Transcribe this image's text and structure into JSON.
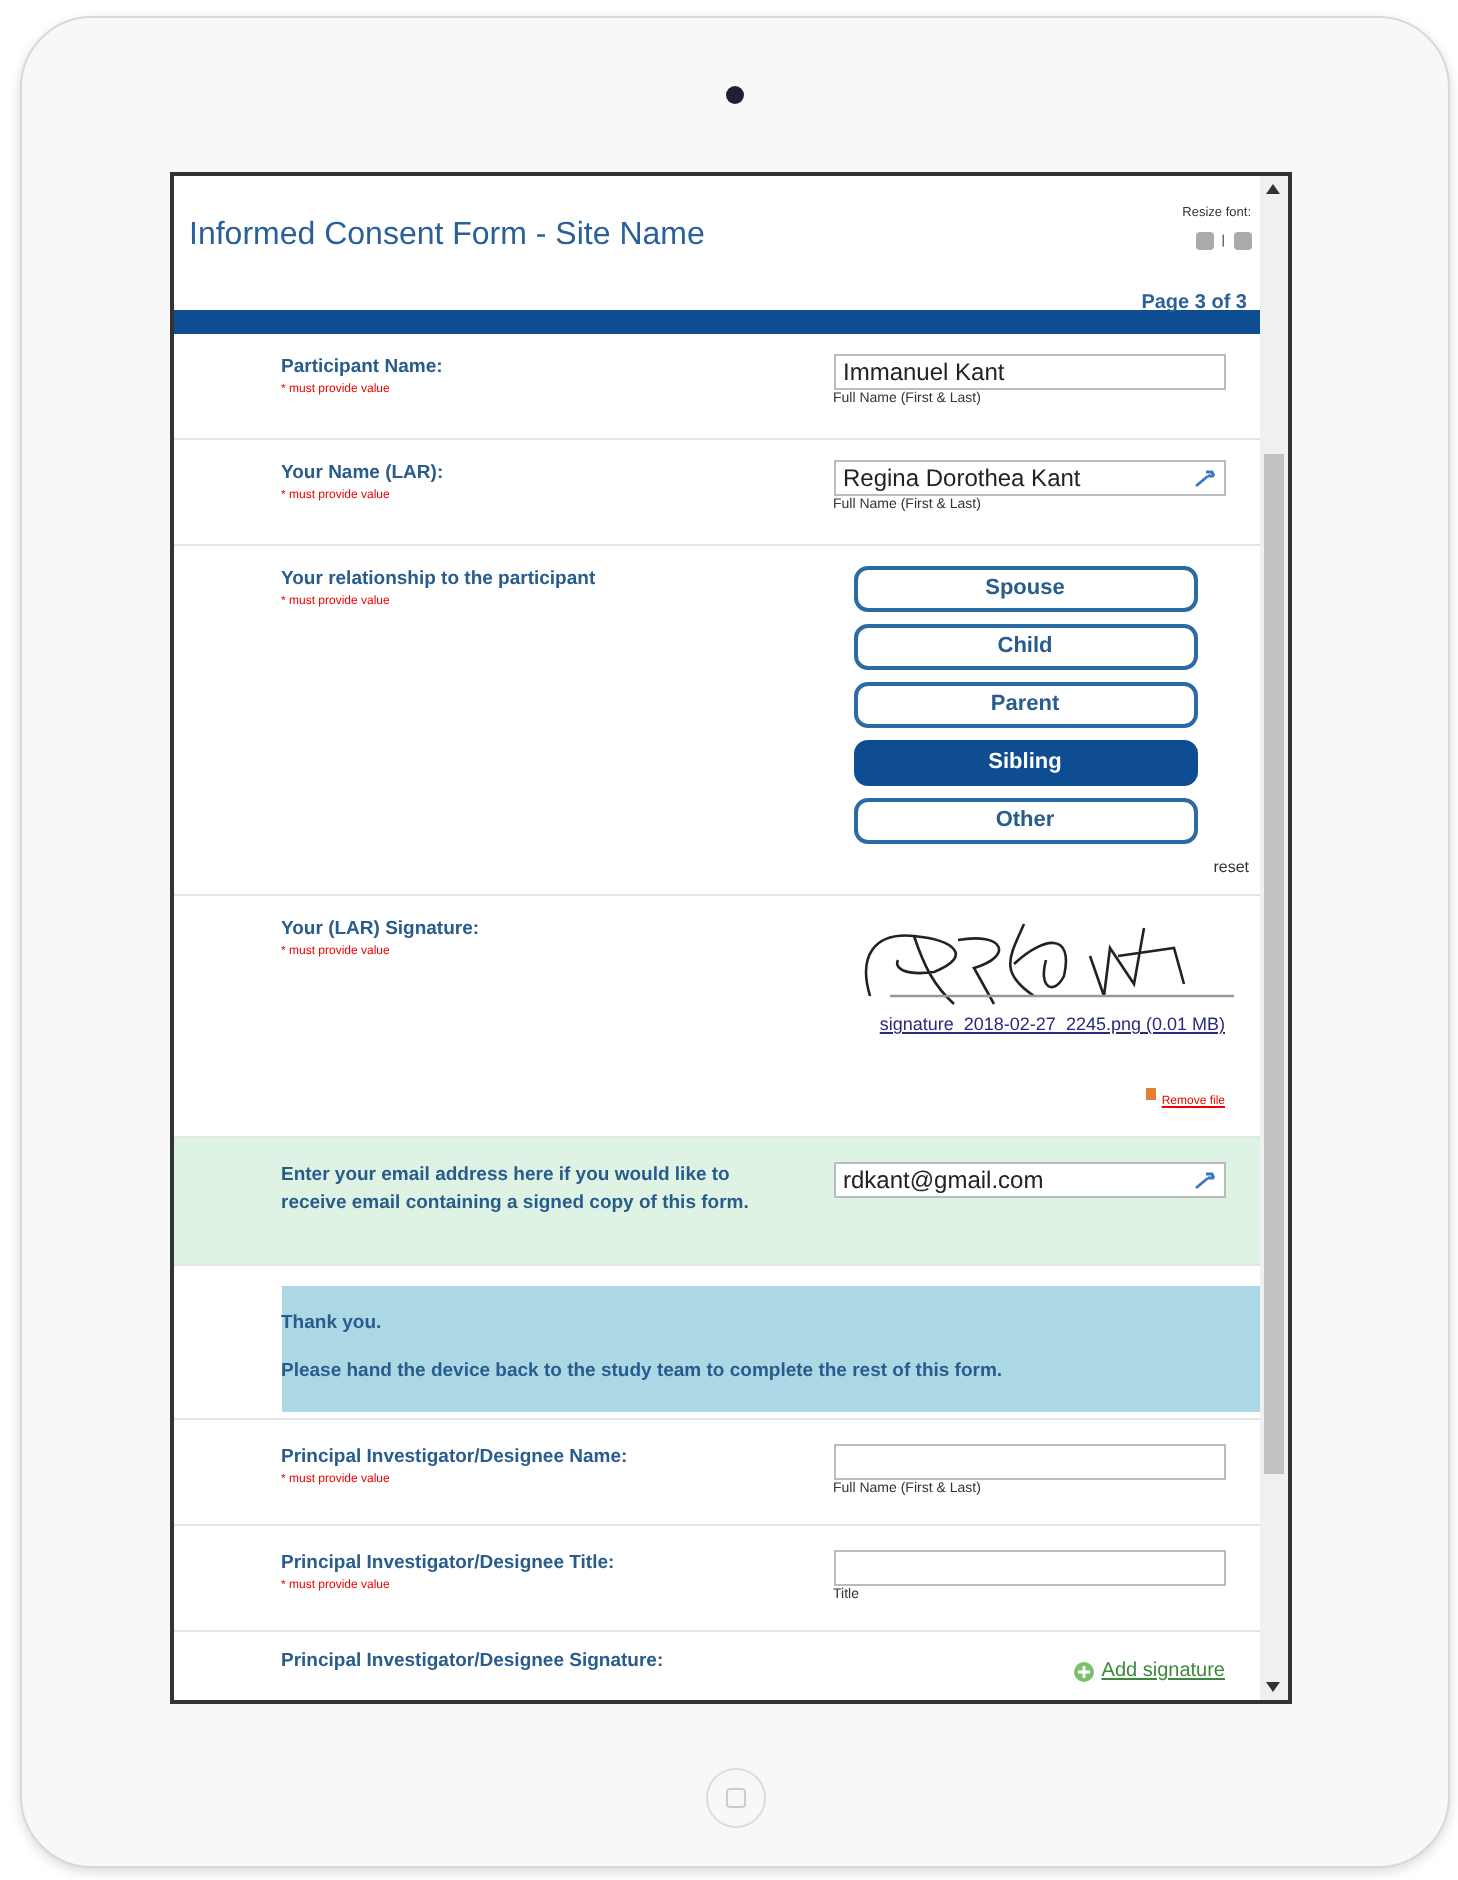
{
  "header": {
    "title": "Informed Consent Form - Site Name",
    "resize_label": "Resize font:",
    "separator": "|",
    "page": "Page 3 of 3"
  },
  "rows": [
    {
      "kind": "text",
      "highlighted": false,
      "label": "Participant Name:",
      "note": "* must provide value",
      "value": "Immanuel Kant",
      "hint": "Full Name (First & Last)",
      "action_icon": false
    },
    {
      "kind": "text",
      "highlighted": false,
      "label": "Your Name (LAR):",
      "note": "* must provide value",
      "value": "Regina Dorothea Kant",
      "hint": "Full Name (First & Last)",
      "action_icon": true
    },
    {
      "kind": "choice",
      "highlighted": false,
      "label": "Your relationship to the participant",
      "note": "* must provide value",
      "options": [
        {
          "label": "Spouse",
          "selected": false
        },
        {
          "label": "Child",
          "selected": false
        },
        {
          "label": "Parent",
          "selected": false
        },
        {
          "label": "Sibling",
          "selected": true
        },
        {
          "label": "Other",
          "selected": false
        }
      ],
      "reset": "reset"
    },
    {
      "kind": "file",
      "highlighted": false,
      "label": "Your (LAR) Signature:",
      "note": "* must provide value",
      "file_link": "signature_2018-02-27_2245.png (0.01 MB)",
      "remove": "Remove file"
    },
    {
      "kind": "text",
      "highlighted": true,
      "label": "Enter your email address here if you would like to receive email containing a signed copy of this form.",
      "value": "rdkant@gmail.com",
      "action_icon": true
    },
    {
      "kind": "notice",
      "lines": [
        "Thank you.",
        "Please hand the device back to the study team to complete the rest of this form."
      ]
    },
    {
      "kind": "text",
      "highlighted": false,
      "label": "Principal Investigator/Designee Name:",
      "note": "* must provide value",
      "value": "",
      "hint": "Full Name (First & Last)",
      "action_icon": false
    },
    {
      "kind": "text",
      "highlighted": false,
      "label": "Principal Investigator/Designee Title:",
      "note": "* must provide value",
      "value": "",
      "hint": "Title",
      "action_icon": false
    },
    {
      "kind": "signature",
      "highlighted": false,
      "label": "Principal Investigator/Designee Signature:",
      "add": "Add signature"
    }
  ]
}
